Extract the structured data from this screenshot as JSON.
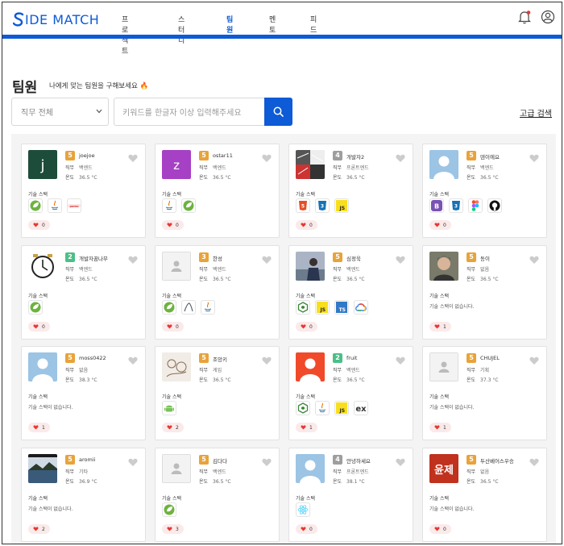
{
  "header": {
    "logo_text": "IDE MATCH",
    "nav": [
      "프로젝트",
      "스터디",
      "팀원",
      "멘토",
      "피드"
    ],
    "active_nav": "팀원",
    "accent": "#0d5bd6"
  },
  "page": {
    "title": "팀원",
    "subtitle": "나에게 맞는 팀원을 구해보세요 🔥"
  },
  "search": {
    "select_value": "직무 전체",
    "placeholder": "키워드를 한글자 이상 입력해주세요",
    "advanced_label": "고급 검색"
  },
  "labels": {
    "job": "직무",
    "temp": "온도",
    "skill_title": "기술 스택",
    "no_skill": "기술 스택이 없습니다."
  },
  "members": [
    {
      "name": "joejoe",
      "level": "5",
      "job": "백엔드",
      "temp": "36.5 °C",
      "avatar": "letter-j",
      "skills": [
        "spring",
        "java",
        "pomo"
      ],
      "likes": "0"
    },
    {
      "name": "ostar11",
      "level": "5",
      "job": "백엔드",
      "temp": "36.5 °C",
      "avatar": "letter-z",
      "skills": [
        "java",
        "spring"
      ],
      "likes": "0"
    },
    {
      "name": "개발자2",
      "level": "4",
      "job": "프론트엔드",
      "temp": "36.5 °C",
      "avatar": "photo-collage",
      "skills": [
        "html5",
        "css3",
        "js"
      ],
      "likes": "0"
    },
    {
      "name": "덴이에요",
      "level": "5",
      "job": "백엔드",
      "temp": "36.5 °C",
      "avatar": "default-blue",
      "skills": [
        "bootstrap",
        "css3",
        "figma",
        "github"
      ],
      "likes": "0"
    },
    {
      "name": "개발자꿈나무",
      "level": "2",
      "job": "백엔드",
      "temp": "36.5 °C",
      "avatar": "clock",
      "skills": [
        "spring"
      ],
      "likes": "0"
    },
    {
      "name": "한성",
      "level": "3",
      "job": "백엔드",
      "temp": "36.5 °C",
      "avatar": "default-gray",
      "skills": [
        "spring",
        "jpa",
        "java"
      ],
      "likes": "0"
    },
    {
      "name": "심정욱",
      "level": "5",
      "job": "백엔드",
      "temp": "36.5 °C",
      "avatar": "photo-person",
      "skills": [
        "nodejs",
        "js",
        "ts",
        "gcp"
      ],
      "likes": "0"
    },
    {
      "name": "동이",
      "level": "5",
      "job": "없음",
      "temp": "36.5 °C",
      "avatar": "photo-man",
      "skills": [],
      "likes": "1"
    },
    {
      "name": "moss0422",
      "level": "5",
      "job": "없음",
      "temp": "38.3 °C",
      "avatar": "default-blue",
      "skills": [],
      "likes": "1"
    },
    {
      "name": "조앙키",
      "level": "5",
      "job": "게임",
      "temp": "36.5 °C",
      "avatar": "photo-sketch",
      "skills": [
        "android"
      ],
      "likes": "2"
    },
    {
      "name": "fruit",
      "level": "2",
      "job": "백엔드",
      "temp": "36.5 °C",
      "avatar": "default-orange",
      "skills": [
        "nodejs",
        "java",
        "js",
        "ex"
      ],
      "likes": "1"
    },
    {
      "name": "CHUJEL",
      "level": "5",
      "job": "기획",
      "temp": "37.3 °C",
      "avatar": "default-gray",
      "skills": [],
      "likes": "1"
    },
    {
      "name": "aromii",
      "level": "5",
      "job": "기타",
      "temp": "36.9 °C",
      "avatar": "photo-lake",
      "skills": [],
      "likes": "2"
    },
    {
      "name": "김다다",
      "level": "5",
      "job": "백엔드",
      "temp": "36.5 °C",
      "avatar": "default-gray",
      "skills": [
        "spring"
      ],
      "likes": "3"
    },
    {
      "name": "안녕하세요",
      "level": "4",
      "job": "프론트엔드",
      "temp": "38.1 °C",
      "avatar": "default-blue",
      "skills": [
        "react"
      ],
      "likes": "0"
    },
    {
      "name": "두산베어스우승",
      "level": "5",
      "job": "없음",
      "temp": "36.5 °C",
      "avatar": "text-윤제",
      "avatar_text": "윤제",
      "skills": [],
      "likes": "0"
    }
  ],
  "level_colors": {
    "2": "#4bbf87",
    "3": "#e8a33a",
    "4": "#9e9e9e",
    "5": "#e8a33a"
  }
}
